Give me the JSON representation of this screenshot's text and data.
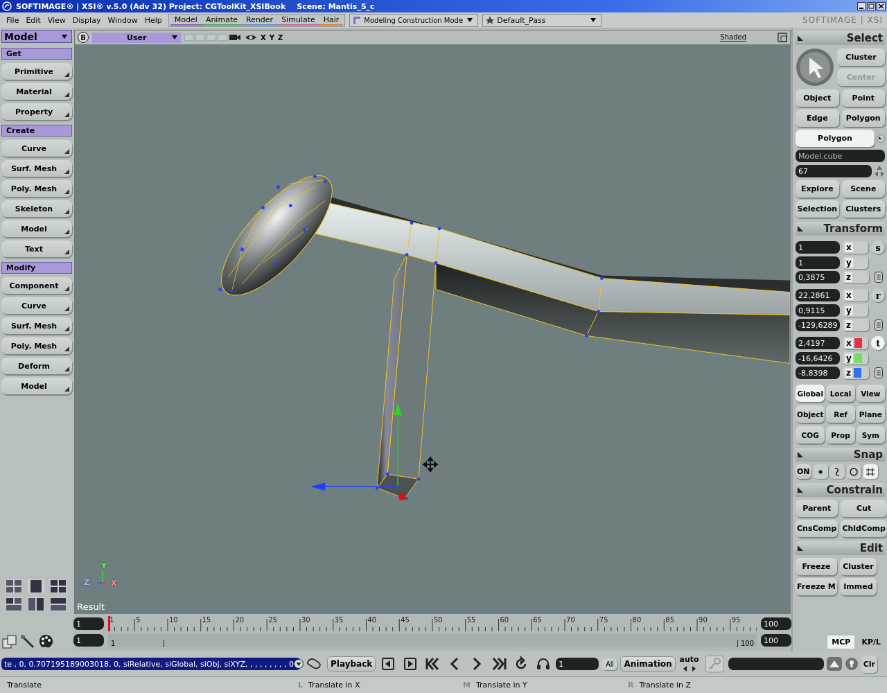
{
  "title_bar": {
    "title": "SOFTIMAGE® | XSI® v.5.0 (Adv 32) Project: CGToolKit_XSIBook",
    "scene": "Scene: Mantis_5_c"
  },
  "menu": [
    "File",
    "Edit",
    "View",
    "Display",
    "Window",
    "Help"
  ],
  "modules": [
    {
      "label": "Model",
      "color": "#8a5cc8"
    },
    {
      "label": "Animate",
      "color": "#4caa4c"
    },
    {
      "label": "Render",
      "color": "#5a8ad0"
    },
    {
      "label": "Simulate",
      "color": "#d060a0"
    },
    {
      "label": "Hair",
      "color": "#e08030"
    }
  ],
  "mode_dropdown": "Modeling Construction Mode",
  "pass_dropdown": "Default_Pass",
  "logo": "SOFTIMAGE | XSI",
  "left_panel": {
    "dropdown": "Model",
    "sections": [
      {
        "title": "Get",
        "buttons": [
          "Primitive",
          "Material",
          "Property"
        ]
      },
      {
        "title": "Create",
        "buttons": [
          "Curve",
          "Surf. Mesh",
          "Poly. Mesh",
          "Skeleton",
          "Model",
          "Text"
        ]
      },
      {
        "title": "Modify",
        "buttons": [
          "Component",
          "Curve",
          "Surf. Mesh",
          "Poly. Mesh",
          "Deform",
          "Model"
        ]
      }
    ]
  },
  "viewport": {
    "badge": "B",
    "camera": "User",
    "axes": [
      "X",
      "Y",
      "Z"
    ],
    "display_mode": "Shaded",
    "label": "Result",
    "gizmo_labels": [
      "Y",
      "Z",
      "X"
    ]
  },
  "select": {
    "title": "Select",
    "top_buttons": [
      {
        "label": "Cluster",
        "disabled": false
      },
      {
        "label": "Center",
        "disabled": true
      }
    ],
    "buttons": [
      "Object",
      "Point",
      "Edge",
      "Polygon"
    ],
    "filter": "Polygon",
    "name_field": "Model.cube",
    "count_field": "67",
    "bottom_buttons": [
      "Explore",
      "Scene",
      "Selection",
      "Clusters"
    ]
  },
  "transform": {
    "title": "Transform",
    "groups": [
      {
        "mode": "s",
        "selected": false,
        "rows": [
          {
            "value": "1",
            "axis": "x"
          },
          {
            "value": "1",
            "axis": "y"
          },
          {
            "value": "0,3875",
            "axis": "z"
          }
        ]
      },
      {
        "mode": "r",
        "selected": false,
        "rows": [
          {
            "value": "22,2861",
            "axis": "x"
          },
          {
            "value": "0,9115",
            "axis": "y"
          },
          {
            "value": "-129,6289",
            "axis": "z"
          }
        ]
      },
      {
        "mode": "t",
        "selected": true,
        "rows": [
          {
            "value": "2,4197",
            "axis": "x",
            "color": "#e83040"
          },
          {
            "value": "-16,6426",
            "axis": "y",
            "color": "#70e060"
          },
          {
            "value": "-8,8398",
            "axis": "z",
            "color": "#3070f0"
          }
        ]
      }
    ],
    "reference": [
      {
        "label": "Global",
        "selected": true
      },
      {
        "label": "Local",
        "selected": false
      },
      {
        "label": "View",
        "selected": false
      },
      {
        "label": "Object",
        "selected": false
      },
      {
        "label": "Ref",
        "selected": false
      },
      {
        "label": "Plane",
        "selected": false
      },
      {
        "label": "COG",
        "selected": false
      },
      {
        "label": "Prop",
        "selected": false
      },
      {
        "label": "Sym",
        "selected": false
      }
    ]
  },
  "snap": {
    "title": "Snap",
    "on_label": "ON",
    "options": [
      {
        "kind": "point",
        "selected": false
      },
      {
        "kind": "curve",
        "selected": false
      },
      {
        "kind": "circle",
        "selected": false
      },
      {
        "kind": "grid",
        "selected": true
      }
    ]
  },
  "constrain": {
    "title": "Constrain",
    "buttons": [
      "Parent",
      "Cut",
      "CnsComp",
      "ChldComp"
    ]
  },
  "edit": {
    "title": "Edit",
    "buttons": [
      "Freeze",
      "Cluster",
      "Freeze M",
      "Immed"
    ]
  },
  "panel_tabs": [
    {
      "label": "MCP",
      "selected": true
    },
    {
      "label": "KP/L",
      "selected": false
    }
  ],
  "timeline": {
    "start_field": "1",
    "end_field": "100",
    "ticks": [
      "1",
      "5",
      "10",
      "15",
      "20",
      "25",
      "30",
      "35",
      "40",
      "45",
      "50",
      "55",
      "60",
      "65",
      "70",
      "75",
      "80",
      "85",
      "90",
      "95"
    ],
    "range_start_field": "1",
    "range_start": "1",
    "range_end": "100",
    "level": 1,
    "range_end_field": "100"
  },
  "command_line": "te , 0, 0.707195189003018, 0, siRelative, siGlobal, siObj, siXYZ, , , , , , , , , 0",
  "playback": {
    "label": "Playback",
    "frame_field": "1",
    "all": "All",
    "animation": "Animation",
    "auto": "auto",
    "clear": "Clr"
  },
  "status_bar": {
    "text": "Translate",
    "hints": [
      {
        "button": "L",
        "text": "Translate in X"
      },
      {
        "button": "M",
        "text": "Translate in Y"
      },
      {
        "button": "R",
        "text": "Translate in Z"
      }
    ]
  }
}
